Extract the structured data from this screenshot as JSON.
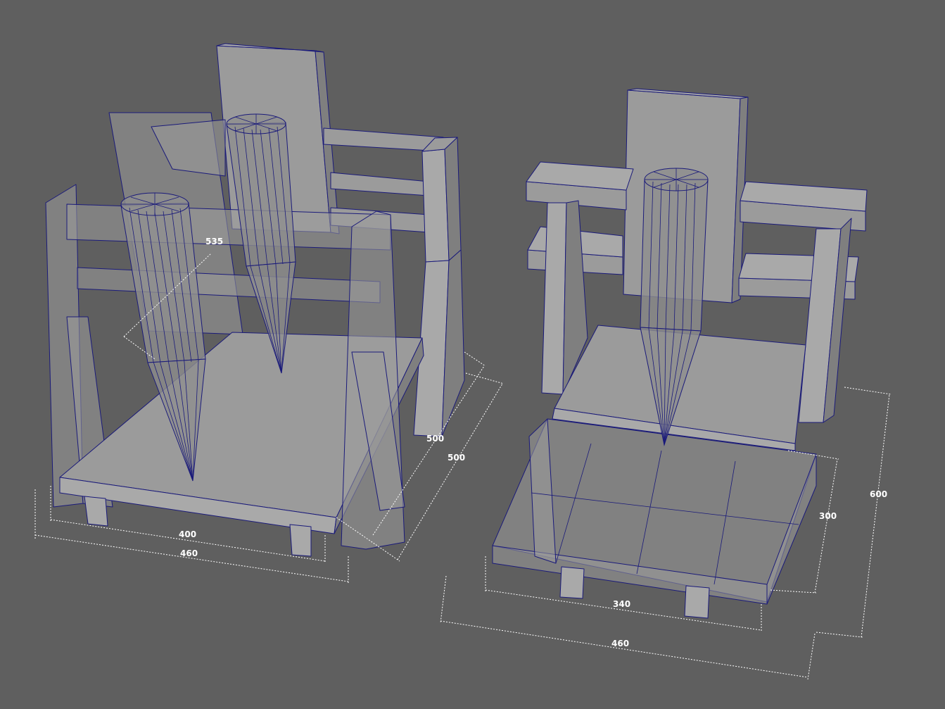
{
  "dimensions": {
    "left_depth": "535",
    "left_width_inner": "400",
    "left_width_outer": "460",
    "left_side_inner": "500",
    "left_side_outer": "500",
    "right_width_inner": "340",
    "right_width_outer": "460",
    "right_depth": "300",
    "right_height": "600"
  },
  "colors": {
    "background": "#5f5f5f",
    "edge": "#1a1a7a",
    "surface": "#9b9b9b",
    "dimension_line": "#ffffff"
  }
}
